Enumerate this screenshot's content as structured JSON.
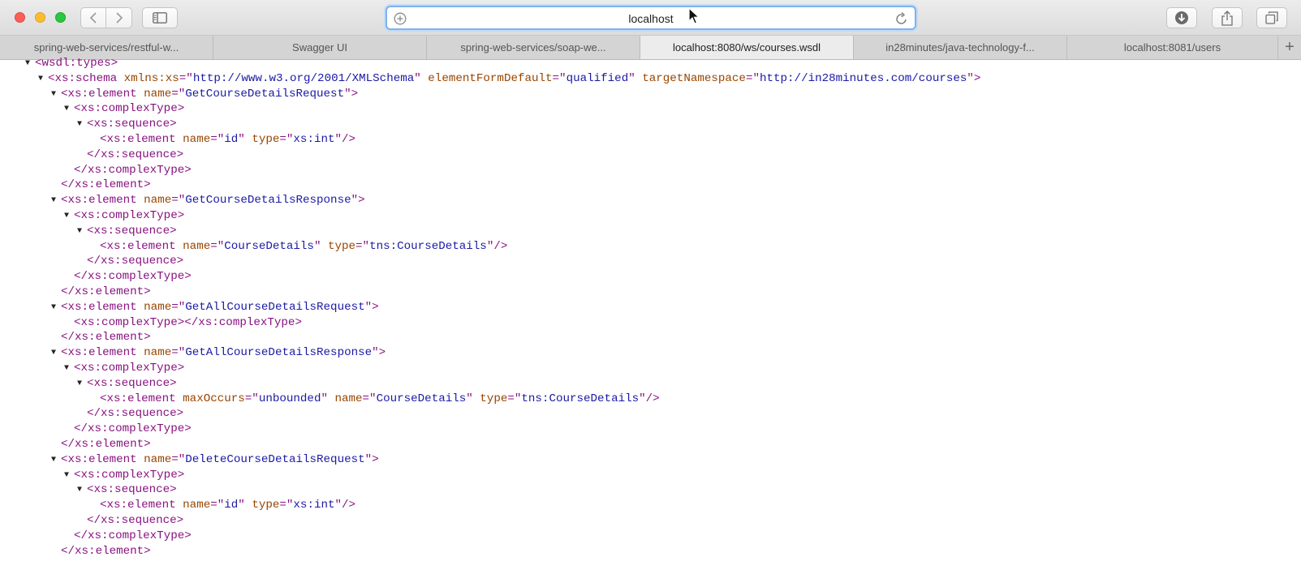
{
  "window": {
    "address": "localhost"
  },
  "toolbar_icons": {
    "back": "chevron-left-icon",
    "forward": "chevron-right-icon",
    "sidebar": "sidebar-icon",
    "download": "download-icon",
    "share": "share-icon",
    "tabs": "tabs-overview-icon"
  },
  "tabs": [
    {
      "label": "spring-web-services/restful-w...",
      "active": false
    },
    {
      "label": "Swagger UI",
      "active": false
    },
    {
      "label": "spring-web-services/soap-we...",
      "active": false
    },
    {
      "label": "localhost:8080/ws/courses.wsdl",
      "active": true
    },
    {
      "label": "in28minutes/java-technology-f...",
      "active": false
    },
    {
      "label": "localhost:8081/users",
      "active": false
    }
  ],
  "new_tab_label": "+",
  "colors": {
    "tag": "#881280",
    "attribute": "#994500",
    "value": "#1a1aa6",
    "address_focus": "#7fb2ea"
  },
  "xml_lines": [
    {
      "indent": 0,
      "toggle": true,
      "parts": [
        [
          "tag",
          "<wsdl:types>"
        ]
      ]
    },
    {
      "indent": 1,
      "toggle": true,
      "parts": [
        [
          "tag",
          "<xs:schema "
        ],
        [
          "attr",
          "xmlns:xs"
        ],
        [
          "tag",
          "=\""
        ],
        [
          "val",
          "http://www.w3.org/2001/XMLSchema"
        ],
        [
          "tag",
          "\" "
        ],
        [
          "attr",
          "elementFormDefault"
        ],
        [
          "tag",
          "=\""
        ],
        [
          "val",
          "qualified"
        ],
        [
          "tag",
          "\" "
        ],
        [
          "attr",
          "targetNamespace"
        ],
        [
          "tag",
          "=\""
        ],
        [
          "val",
          "http://in28minutes.com/courses"
        ],
        [
          "tag",
          "\">"
        ]
      ]
    },
    {
      "indent": 2,
      "toggle": true,
      "parts": [
        [
          "tag",
          "<xs:element "
        ],
        [
          "attr",
          "name"
        ],
        [
          "tag",
          "=\""
        ],
        [
          "val",
          "GetCourseDetailsRequest"
        ],
        [
          "tag",
          "\">"
        ]
      ]
    },
    {
      "indent": 3,
      "toggle": true,
      "parts": [
        [
          "tag",
          "<xs:complexType>"
        ]
      ]
    },
    {
      "indent": 4,
      "toggle": true,
      "parts": [
        [
          "tag",
          "<xs:sequence>"
        ]
      ]
    },
    {
      "indent": 5,
      "toggle": false,
      "parts": [
        [
          "tag",
          "<xs:element "
        ],
        [
          "attr",
          "name"
        ],
        [
          "tag",
          "=\""
        ],
        [
          "val",
          "id"
        ],
        [
          "tag",
          "\" "
        ],
        [
          "attr",
          "type"
        ],
        [
          "tag",
          "=\""
        ],
        [
          "val",
          "xs:int"
        ],
        [
          "tag",
          "\"/>"
        ]
      ]
    },
    {
      "indent": 4,
      "toggle": false,
      "parts": [
        [
          "tag",
          "</xs:sequence>"
        ]
      ]
    },
    {
      "indent": 3,
      "toggle": false,
      "parts": [
        [
          "tag",
          "</xs:complexType>"
        ]
      ]
    },
    {
      "indent": 2,
      "toggle": false,
      "parts": [
        [
          "tag",
          "</xs:element>"
        ]
      ]
    },
    {
      "indent": 2,
      "toggle": true,
      "parts": [
        [
          "tag",
          "<xs:element "
        ],
        [
          "attr",
          "name"
        ],
        [
          "tag",
          "=\""
        ],
        [
          "val",
          "GetCourseDetailsResponse"
        ],
        [
          "tag",
          "\">"
        ]
      ]
    },
    {
      "indent": 3,
      "toggle": true,
      "parts": [
        [
          "tag",
          "<xs:complexType>"
        ]
      ]
    },
    {
      "indent": 4,
      "toggle": true,
      "parts": [
        [
          "tag",
          "<xs:sequence>"
        ]
      ]
    },
    {
      "indent": 5,
      "toggle": false,
      "parts": [
        [
          "tag",
          "<xs:element "
        ],
        [
          "attr",
          "name"
        ],
        [
          "tag",
          "=\""
        ],
        [
          "val",
          "CourseDetails"
        ],
        [
          "tag",
          "\" "
        ],
        [
          "attr",
          "type"
        ],
        [
          "tag",
          "=\""
        ],
        [
          "val",
          "tns:CourseDetails"
        ],
        [
          "tag",
          "\"/>"
        ]
      ]
    },
    {
      "indent": 4,
      "toggle": false,
      "parts": [
        [
          "tag",
          "</xs:sequence>"
        ]
      ]
    },
    {
      "indent": 3,
      "toggle": false,
      "parts": [
        [
          "tag",
          "</xs:complexType>"
        ]
      ]
    },
    {
      "indent": 2,
      "toggle": false,
      "parts": [
        [
          "tag",
          "</xs:element>"
        ]
      ]
    },
    {
      "indent": 2,
      "toggle": true,
      "parts": [
        [
          "tag",
          "<xs:element "
        ],
        [
          "attr",
          "name"
        ],
        [
          "tag",
          "=\""
        ],
        [
          "val",
          "GetAllCourseDetailsRequest"
        ],
        [
          "tag",
          "\">"
        ]
      ]
    },
    {
      "indent": 3,
      "toggle": false,
      "parts": [
        [
          "tag",
          "<xs:complexType></xs:complexType>"
        ]
      ]
    },
    {
      "indent": 2,
      "toggle": false,
      "parts": [
        [
          "tag",
          "</xs:element>"
        ]
      ]
    },
    {
      "indent": 2,
      "toggle": true,
      "parts": [
        [
          "tag",
          "<xs:element "
        ],
        [
          "attr",
          "name"
        ],
        [
          "tag",
          "=\""
        ],
        [
          "val",
          "GetAllCourseDetailsResponse"
        ],
        [
          "tag",
          "\">"
        ]
      ]
    },
    {
      "indent": 3,
      "toggle": true,
      "parts": [
        [
          "tag",
          "<xs:complexType>"
        ]
      ]
    },
    {
      "indent": 4,
      "toggle": true,
      "parts": [
        [
          "tag",
          "<xs:sequence>"
        ]
      ]
    },
    {
      "indent": 5,
      "toggle": false,
      "parts": [
        [
          "tag",
          "<xs:element "
        ],
        [
          "attr",
          "maxOccurs"
        ],
        [
          "tag",
          "=\""
        ],
        [
          "val",
          "unbounded"
        ],
        [
          "tag",
          "\" "
        ],
        [
          "attr",
          "name"
        ],
        [
          "tag",
          "=\""
        ],
        [
          "val",
          "CourseDetails"
        ],
        [
          "tag",
          "\" "
        ],
        [
          "attr",
          "type"
        ],
        [
          "tag",
          "=\""
        ],
        [
          "val",
          "tns:CourseDetails"
        ],
        [
          "tag",
          "\"/>"
        ]
      ]
    },
    {
      "indent": 4,
      "toggle": false,
      "parts": [
        [
          "tag",
          "</xs:sequence>"
        ]
      ]
    },
    {
      "indent": 3,
      "toggle": false,
      "parts": [
        [
          "tag",
          "</xs:complexType>"
        ]
      ]
    },
    {
      "indent": 2,
      "toggle": false,
      "parts": [
        [
          "tag",
          "</xs:element>"
        ]
      ]
    },
    {
      "indent": 2,
      "toggle": true,
      "parts": [
        [
          "tag",
          "<xs:element "
        ],
        [
          "attr",
          "name"
        ],
        [
          "tag",
          "=\""
        ],
        [
          "val",
          "DeleteCourseDetailsRequest"
        ],
        [
          "tag",
          "\">"
        ]
      ]
    },
    {
      "indent": 3,
      "toggle": true,
      "parts": [
        [
          "tag",
          "<xs:complexType>"
        ]
      ]
    },
    {
      "indent": 4,
      "toggle": true,
      "parts": [
        [
          "tag",
          "<xs:sequence>"
        ]
      ]
    },
    {
      "indent": 5,
      "toggle": false,
      "parts": [
        [
          "tag",
          "<xs:element "
        ],
        [
          "attr",
          "name"
        ],
        [
          "tag",
          "=\""
        ],
        [
          "val",
          "id"
        ],
        [
          "tag",
          "\" "
        ],
        [
          "attr",
          "type"
        ],
        [
          "tag",
          "=\""
        ],
        [
          "val",
          "xs:int"
        ],
        [
          "tag",
          "\"/>"
        ]
      ]
    },
    {
      "indent": 4,
      "toggle": false,
      "parts": [
        [
          "tag",
          "</xs:sequence>"
        ]
      ]
    },
    {
      "indent": 3,
      "toggle": false,
      "parts": [
        [
          "tag",
          "</xs:complexType>"
        ]
      ]
    },
    {
      "indent": 2,
      "toggle": false,
      "parts": [
        [
          "tag",
          "</xs:element>"
        ]
      ]
    }
  ]
}
